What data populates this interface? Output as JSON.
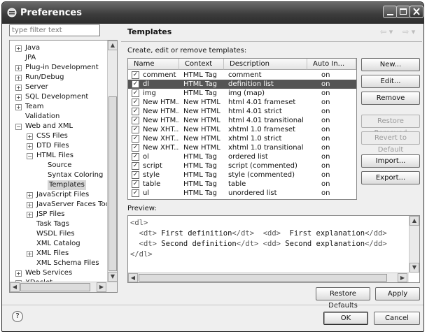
{
  "window": {
    "title": "Preferences"
  },
  "filter": {
    "placeholder": "type filter text"
  },
  "tree": [
    {
      "label": "Java",
      "level": 0,
      "expander": "+"
    },
    {
      "label": "JPA",
      "level": 0,
      "expander": ""
    },
    {
      "label": "Plug-in Development",
      "level": 0,
      "expander": "+"
    },
    {
      "label": "Run/Debug",
      "level": 0,
      "expander": "+"
    },
    {
      "label": "Server",
      "level": 0,
      "expander": "+"
    },
    {
      "label": "SQL Development",
      "level": 0,
      "expander": "+"
    },
    {
      "label": "Team",
      "level": 0,
      "expander": "+"
    },
    {
      "label": "Validation",
      "level": 0,
      "expander": ""
    },
    {
      "label": "Web and XML",
      "level": 0,
      "expander": "−"
    },
    {
      "label": "CSS Files",
      "level": 1,
      "expander": "+"
    },
    {
      "label": "DTD Files",
      "level": 1,
      "expander": "+"
    },
    {
      "label": "HTML Files",
      "level": 1,
      "expander": "−"
    },
    {
      "label": "Source",
      "level": 2,
      "expander": ""
    },
    {
      "label": "Syntax Coloring",
      "level": 2,
      "expander": ""
    },
    {
      "label": "Templates",
      "level": 2,
      "expander": "",
      "selected": true
    },
    {
      "label": "JavaScript Files",
      "level": 1,
      "expander": "+"
    },
    {
      "label": "JavaServer Faces Tools",
      "level": 1,
      "expander": "+"
    },
    {
      "label": "JSP Files",
      "level": 1,
      "expander": "+"
    },
    {
      "label": "Task Tags",
      "level": 1,
      "expander": ""
    },
    {
      "label": "WSDL Files",
      "level": 1,
      "expander": ""
    },
    {
      "label": "XML Catalog",
      "level": 1,
      "expander": ""
    },
    {
      "label": "XML Files",
      "level": 1,
      "expander": "+"
    },
    {
      "label": "XML Schema Files",
      "level": 1,
      "expander": ""
    },
    {
      "label": "Web Services",
      "level": 0,
      "expander": "+"
    },
    {
      "label": "XDoclet",
      "level": 0,
      "expander": "+"
    }
  ],
  "panel": {
    "title": "Templates",
    "description": "Create, edit or remove templates:"
  },
  "table": {
    "columns": [
      "Name",
      "Context",
      "Description",
      "Auto In..."
    ],
    "rows": [
      {
        "name": "comment",
        "context": "HTML Tag",
        "description": "comment",
        "auto": "on",
        "checked": true
      },
      {
        "name": "dl",
        "context": "HTML Tag",
        "description": "definition list",
        "auto": "on",
        "checked": true,
        "selected": true
      },
      {
        "name": "img",
        "context": "HTML Tag",
        "description": "img     (map)",
        "auto": "on",
        "checked": true
      },
      {
        "name": "New HTM...",
        "context": "New HTML",
        "description": "html 4.01 frameset",
        "auto": "on",
        "checked": true
      },
      {
        "name": "New HTM...",
        "context": "New HTML",
        "description": "html 4.01 strict",
        "auto": "on",
        "checked": true
      },
      {
        "name": "New HTM...",
        "context": "New HTML",
        "description": "html 4.01 transitional",
        "auto": "on",
        "checked": true
      },
      {
        "name": "New XHT...",
        "context": "New HTML",
        "description": "xhtml 1.0 frameset",
        "auto": "on",
        "checked": true
      },
      {
        "name": "New XHT...",
        "context": "New HTML",
        "description": "xhtml 1.0 strict",
        "auto": "on",
        "checked": true
      },
      {
        "name": "New XHT...",
        "context": "New HTML",
        "description": "xhtml 1.0 transitional",
        "auto": "on",
        "checked": true
      },
      {
        "name": "ol",
        "context": "HTML Tag",
        "description": "ordered list",
        "auto": "on",
        "checked": true
      },
      {
        "name": "script",
        "context": "HTML Tag",
        "description": "script     (commented)",
        "auto": "on",
        "checked": true
      },
      {
        "name": "style",
        "context": "HTML Tag",
        "description": "style     (commented)",
        "auto": "on",
        "checked": true
      },
      {
        "name": "table",
        "context": "HTML Tag",
        "description": "table",
        "auto": "on",
        "checked": true
      },
      {
        "name": "ul",
        "context": "HTML Tag",
        "description": "unordered list",
        "auto": "on",
        "checked": true
      }
    ]
  },
  "buttons": {
    "new": "New...",
    "edit": "Edit...",
    "remove": "Remove",
    "restore_removed": "Restore Removed",
    "revert_default": "Revert to Default",
    "import": "Import...",
    "export": "Export...",
    "restore_defaults": "Restore Defaults",
    "apply": "Apply",
    "ok": "OK",
    "cancel": "Cancel"
  },
  "preview": {
    "label": "Preview:",
    "lines": [
      [
        "<dl>"
      ],
      [
        "  ",
        "<dt>",
        " First definition",
        "</dt>",
        "  ",
        "<dd>",
        "  First explanation",
        "</dd>"
      ],
      [
        "  ",
        "<dt>",
        " Second definition",
        "</dt>",
        " ",
        "<dd>",
        " Second explanation",
        "</dd>"
      ],
      [
        "</dl>"
      ]
    ]
  },
  "icons": {
    "window": "preferences-icon",
    "minimize": "minimize-icon",
    "maximize": "maximize-icon",
    "close": "close-icon",
    "back": "back-arrow-icon",
    "forward": "forward-arrow-icon",
    "help": "help-icon"
  }
}
